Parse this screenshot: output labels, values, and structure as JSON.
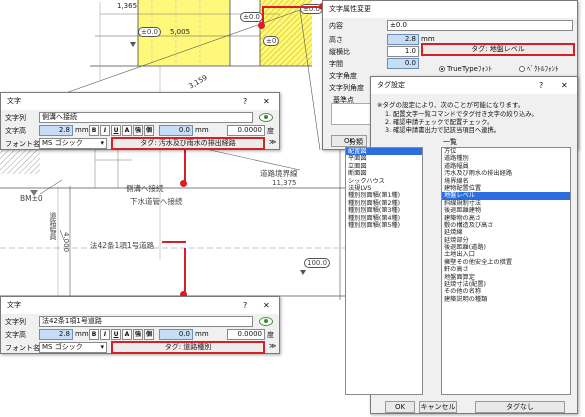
{
  "drawing": {
    "dim_1365": "1,365",
    "dim_5005": "5,005",
    "dim_3159": "3,159",
    "dim_4": "4,",
    "elev_0_top": "±0.0",
    "elev_0_mid": "±0.0",
    "elev_0_small": "±0",
    "road_boundary": "道路境界線",
    "road_boundary_dim": "11,375",
    "side_drain": "側溝へ接続",
    "sewer": "下水道管へ接続",
    "bm": "BM±0",
    "road_article": "法42条1項1号道路",
    "road_width": "道路幅員",
    "road_width_val": "4.000",
    "elev_100": "100.0",
    "elev_0_right": "±0.0"
  },
  "attr_dialog": {
    "title": "文字属性変更",
    "labels": [
      "内容",
      "高さ",
      "縦横比",
      "字間",
      "文字角度",
      "文字列角度",
      "基準点"
    ],
    "content_value": "±0.0",
    "height_value": "2.8",
    "height_unit": "mm",
    "ratio_value": "1.0",
    "spacing_value": "0.0",
    "tag_button": "タグ: 地盤レベル",
    "truetype_label": "TrueTypeﾌｫﾝﾄ",
    "vector_label": "ﾍﾞｸﾄﾙﾌｫﾝﾄ",
    "ok": "OK"
  },
  "text_dialog_1": {
    "title": "文字",
    "help": "?",
    "close": "✕",
    "label_string": "文字列",
    "label_height": "文字高",
    "label_font": "フォント名",
    "string_value": "側溝へ接続",
    "height_value": "2.8",
    "unit_mm": "mm",
    "style_buttons": [
      "B",
      "I",
      "U",
      "A",
      "強",
      "個"
    ],
    "spacing_value": "0.0",
    "angle_value": "0.0000",
    "unit_deg": "度",
    "font_value": "MS ゴシック",
    "tag_button": "タグ: 汚水及び雨水の排出経路"
  },
  "text_dialog_2": {
    "title": "文字",
    "help": "?",
    "close": "✕",
    "label_string": "文字列",
    "label_height": "文字高",
    "label_font": "フォント名",
    "string_value": "法42条1項1号道路",
    "height_value": "2.8",
    "unit_mm": "mm",
    "style_buttons": [
      "B",
      "I",
      "U",
      "A",
      "強",
      "個"
    ],
    "spacing_value": "0.0",
    "angle_value": "0.0000",
    "unit_deg": "度",
    "font_value": "MS ゴシック",
    "tag_button": "タグ: 道路種別"
  },
  "tag_dialog": {
    "title": "タグ設定",
    "help": "?",
    "close": "✕",
    "note_intro": "※タグの設定により、次のことが可能になります。",
    "note_1": "1. 配置文字一覧コマンドでタグ付き文字の絞り込み。",
    "note_2": "2. 確認申請チェックで配置チェック。",
    "note_3": "3. 確認申請書出力で記該当項目へ連携。",
    "category_label": "分類",
    "list_label": "一覧",
    "categories": [
      "配置図",
      "平面図",
      "立面図",
      "断面図",
      "シックハウス",
      "法規LVS",
      "種別別面積(第1種)",
      "種別別面積(第2種)",
      "種別別面積(第3種)",
      "種別別面積(第4種)",
      "種別別面積(第5種)"
    ],
    "items": [
      "方位",
      "道路種別",
      "道路幅員",
      "汚水及び雨水の排出経路",
      "境界線名",
      "建物配置位置",
      "地盤レベル",
      "斜線規制寸法",
      "後退距離建物",
      "建築物の高さ",
      "敷の構造及び高さ",
      "延焼線",
      "延焼部分",
      "後退距離(道路)",
      "土地出入口",
      "擁壁その他安全上の措置",
      "軒の高さ",
      "地盤面算定",
      "延焼寸法(配置)",
      "その他の名称",
      "建築説明の種類"
    ],
    "selected_category": 0,
    "selected_item": 6,
    "ok": "OK",
    "cancel": "キャンセル",
    "no_tag": "タグなし"
  }
}
